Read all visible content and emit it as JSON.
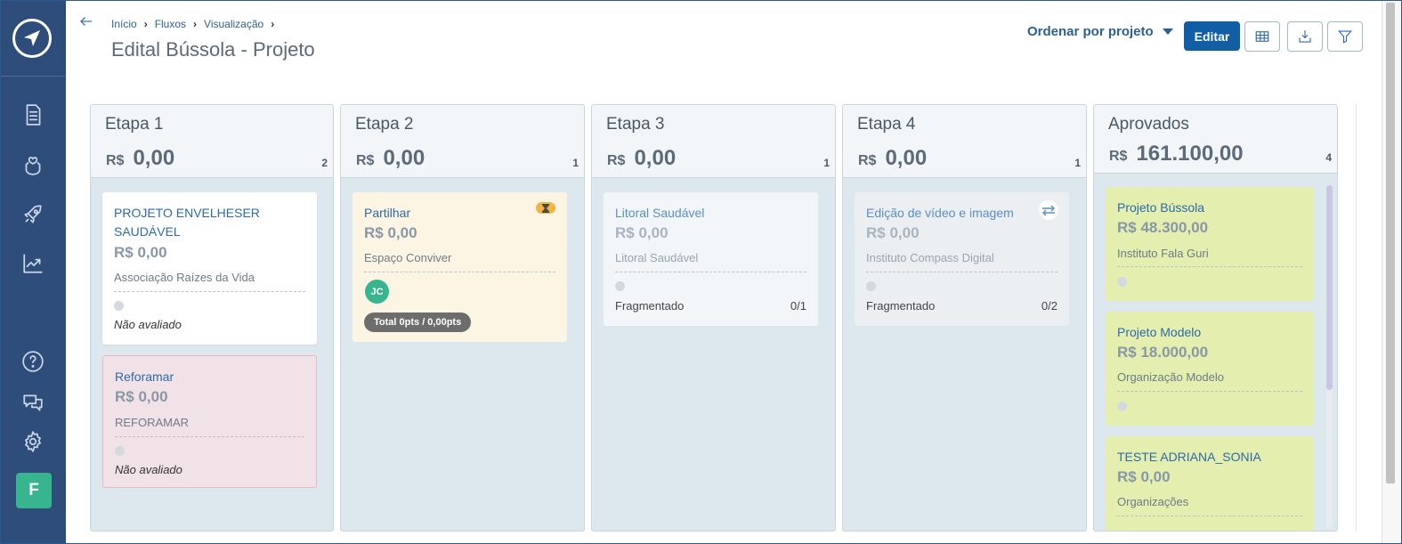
{
  "sidebar": {
    "logo": "compass-logo-icon",
    "items": [
      {
        "icon": "document-icon"
      },
      {
        "icon": "hand-heart-icon"
      },
      {
        "icon": "rocket-icon"
      },
      {
        "icon": "chart-trend-icon"
      },
      {
        "icon": "help-circle-icon"
      },
      {
        "icon": "chat-bubbles-icon"
      },
      {
        "icon": "gear-icon"
      }
    ],
    "user_initial": "F",
    "user_color": "#36b58f"
  },
  "header": {
    "breadcrumb": [
      "Início",
      "Fluxos",
      "Visualização"
    ],
    "title": "Edital Bússola - Projeto",
    "sort_label": "Ordenar por projeto",
    "edit_label": "Editar",
    "icons": [
      "table-icon",
      "download-icon",
      "filter-icon"
    ]
  },
  "columns": [
    {
      "title": "Etapa 1",
      "currency": "R$",
      "total": "0,00",
      "count": "2",
      "cards": [
        {
          "title": "PROJETO ENVELHESER SAUDÁVEL",
          "value": "R$  0,00",
          "org": "Associação Raízes da Vida",
          "status": "Não avaliado",
          "bg": "#ffffff"
        },
        {
          "title": "Reforamar",
          "value": "R$  0,00",
          "org": "REFORAMAR",
          "status": "Não avaliado",
          "bg": "#f0e2e6"
        }
      ]
    },
    {
      "title": "Etapa 2",
      "currency": "R$",
      "total": "0,00",
      "count": "1",
      "cards": [
        {
          "title": "Partilhar",
          "value": "R$  0,00",
          "org": "Espaço Conviver",
          "avatar": "JC",
          "pill": "Total 0pts / 0,00pts",
          "badge": "hourglass-icon",
          "bg": "#fdf5e3"
        }
      ]
    },
    {
      "title": "Etapa 3",
      "currency": "R$",
      "total": "0,00",
      "count": "1",
      "cards": [
        {
          "title": "Litoral Saudável",
          "value": "R$  0,00",
          "org": "Litoral Saudável",
          "label": "Fragmentado",
          "fraction": "0/1",
          "bg": "#f2f6f8"
        }
      ]
    },
    {
      "title": "Etapa 4",
      "currency": "R$",
      "total": "0,00",
      "count": "1",
      "cards": [
        {
          "title": "Edição de vídeo e imagem",
          "value": "R$  0,00",
          "org": "Instituto Compass Digital",
          "label": "Fragmentado",
          "fraction": "0/2",
          "badge": "transfer-arrows-icon",
          "bg": "#eceff1"
        }
      ]
    },
    {
      "title": "Aprovados",
      "currency": "R$",
      "total": "161.100,00",
      "count": "4",
      "cards": [
        {
          "title": "Projeto Bússola",
          "value": "R$  48.300,00",
          "org": "Instituto Fala Guri",
          "bg": "#e3eeaf"
        },
        {
          "title": "Projeto Modelo",
          "value": "R$  18.000,00",
          "org": "Organização Modelo",
          "bg": "#e3eeaf"
        },
        {
          "title": "TESTE ADRIANA_SONIA",
          "value": "R$  0,00",
          "org": "Organizações",
          "bg": "#e3eeaf"
        }
      ]
    }
  ]
}
